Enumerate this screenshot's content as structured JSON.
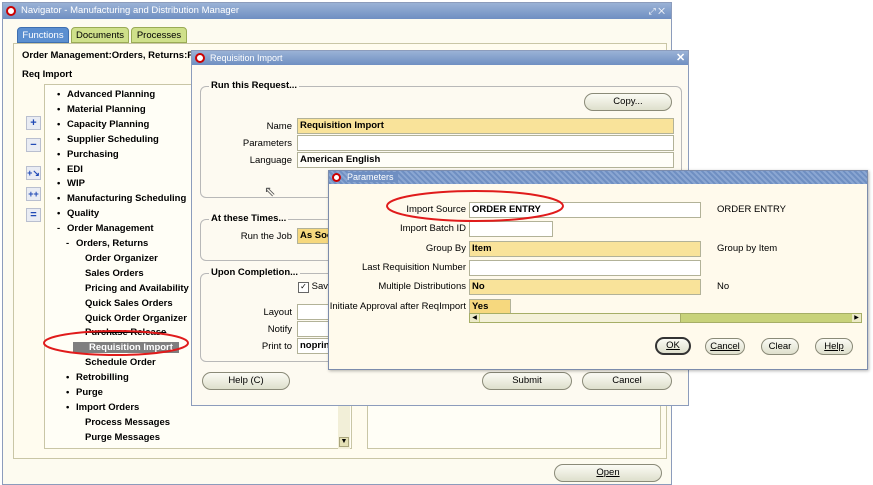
{
  "navigator": {
    "title": "Navigator - Manufacturing and Distribution Manager",
    "tabs": [
      "Functions",
      "Documents",
      "Processes"
    ],
    "breadcrumb": "Order Management:Orders, Returns:R",
    "current": "Req Import",
    "open_label": "Open",
    "tree": [
      {
        "label": "Advanced Planning",
        "bullet": "•"
      },
      {
        "label": "Material Planning",
        "bullet": "•"
      },
      {
        "label": "Capacity Planning",
        "bullet": "•"
      },
      {
        "label": "Supplier Scheduling",
        "bullet": "•"
      },
      {
        "label": "Purchasing",
        "bullet": "•"
      },
      {
        "label": "EDI",
        "bullet": "•"
      },
      {
        "label": "WIP",
        "bullet": "•"
      },
      {
        "label": "Manufacturing Scheduling",
        "bullet": "•"
      },
      {
        "label": "Quality",
        "bullet": "•"
      },
      {
        "label": "Order Management",
        "bullet": "-"
      },
      {
        "label": "Orders, Returns",
        "bullet": "-"
      },
      {
        "label": "Order Organizer",
        "bullet": ""
      },
      {
        "label": "Sales Orders",
        "bullet": ""
      },
      {
        "label": "Pricing and Availability",
        "bullet": ""
      },
      {
        "label": "Quick Sales Orders",
        "bullet": ""
      },
      {
        "label": "Quick Order Organizer",
        "bullet": ""
      },
      {
        "label": "Purchase Release",
        "bullet": ""
      },
      {
        "label": "Requisition Import",
        "bullet": ""
      },
      {
        "label": "Schedule Order",
        "bullet": ""
      },
      {
        "label": "Retrobilling",
        "bullet": "•"
      },
      {
        "label": "Purge",
        "bullet": "•"
      },
      {
        "label": "Import Orders",
        "bullet": "•"
      },
      {
        "label": "Process Messages",
        "bullet": ""
      },
      {
        "label": "Purge Messages",
        "bullet": ""
      }
    ]
  },
  "request": {
    "title": "Requisition Import",
    "run_section": "Run this Request...",
    "copy_label": "Copy...",
    "name_label": "Name",
    "name_value": "Requisition Import",
    "parameters_label": "Parameters",
    "language_label": "Language",
    "language_value": "American English",
    "times_section": "At these Times...",
    "run_job_label": "Run the Job",
    "run_job_value": "As Soo",
    "completion_section": "Upon Completion...",
    "save_label": "Save",
    "layout_label": "Layout",
    "notify_label": "Notify",
    "print_to_label": "Print to",
    "print_to_value": "noprin",
    "help_label": "Help (C)",
    "submit_label": "Submit",
    "cancel_label": "Cancel"
  },
  "parameters": {
    "title": "Parameters",
    "rows": [
      {
        "label": "Import Source",
        "value": "ORDER ENTRY",
        "desc": "ORDER ENTRY",
        "style": "plain"
      },
      {
        "label": "Import Batch ID",
        "value": "",
        "desc": "",
        "style": "plain"
      },
      {
        "label": "Group By",
        "value": "Item",
        "desc": "Group by Item",
        "style": "req"
      },
      {
        "label": "Last Requisition Number",
        "value": "",
        "desc": "",
        "style": "plain"
      },
      {
        "label": "Multiple Distributions",
        "value": "No",
        "desc": "No",
        "style": "req"
      },
      {
        "label": "Initiate Approval after ReqImport",
        "value": "Yes",
        "desc": "",
        "style": "ro"
      }
    ],
    "ok_label": "OK",
    "cancel_label": "Cancel",
    "clear_label": "Clear",
    "help_label": "Help"
  },
  "colors": {
    "title_bar": "#7f9dcc",
    "window_bg": "#fffaf0",
    "required_field": "#f9e39a",
    "annotation": "#e01b1b"
  }
}
